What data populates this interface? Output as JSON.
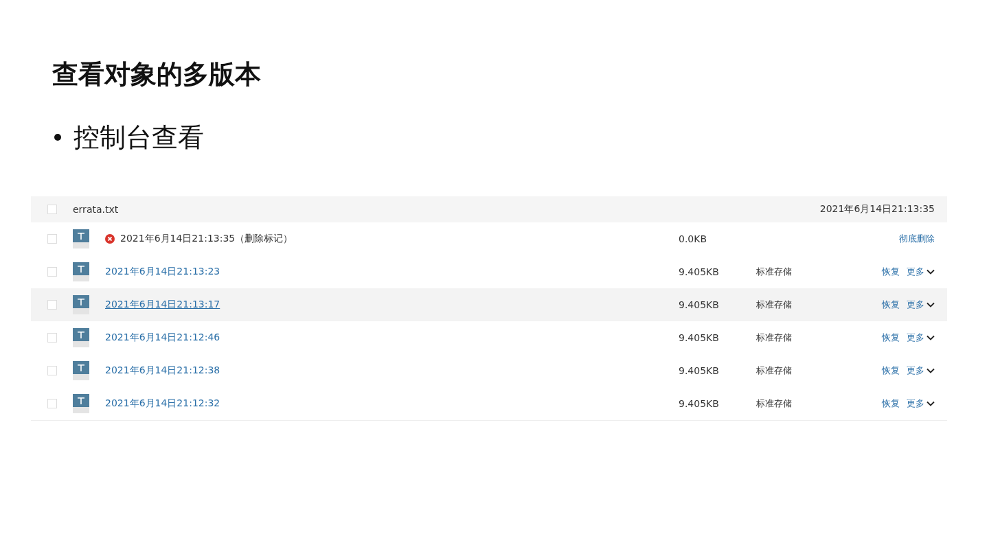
{
  "title": "查看对象的多版本",
  "bullets": [
    "控制台查看"
  ],
  "table": {
    "header": {
      "checked": false,
      "name": "errata.txt",
      "date": "2021年6月14日21:13:35"
    },
    "rows": [
      {
        "kind": "delete_marker",
        "checked": false,
        "hovered": false,
        "name": "2021年6月14日21:13:35（删除标记）",
        "size": "0.0KB",
        "actions": [
          "彻底删除"
        ]
      },
      {
        "kind": "version",
        "checked": false,
        "hovered": false,
        "name": "2021年6月14日21:13:23",
        "size": "9.405KB",
        "storage": "标准存储",
        "actions": [
          "恢复",
          "更多"
        ]
      },
      {
        "kind": "version",
        "checked": false,
        "hovered": true,
        "name": "2021年6月14日21:13:17",
        "size": "9.405KB",
        "storage": "标准存储",
        "actions": [
          "恢复",
          "更多"
        ]
      },
      {
        "kind": "version",
        "checked": false,
        "hovered": false,
        "name": "2021年6月14日21:12:46",
        "size": "9.405KB",
        "storage": "标准存储",
        "actions": [
          "恢复",
          "更多"
        ]
      },
      {
        "kind": "version",
        "checked": false,
        "hovered": false,
        "name": "2021年6月14日21:12:38",
        "size": "9.405KB",
        "storage": "标准存储",
        "actions": [
          "恢复",
          "更多"
        ]
      },
      {
        "kind": "version",
        "checked": false,
        "hovered": false,
        "name": "2021年6月14日21:12:32",
        "size": "9.405KB",
        "storage": "标准存储",
        "actions": [
          "恢复",
          "更多"
        ]
      }
    ]
  }
}
